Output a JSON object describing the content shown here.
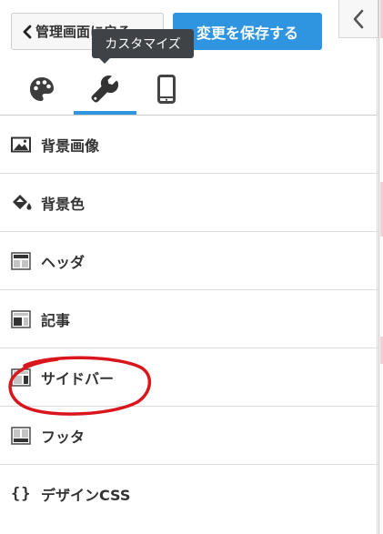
{
  "header": {
    "back_label": "管理画面に戻る",
    "save_label": "変更を保存する"
  },
  "tooltip": {
    "text": "カスタマイズ"
  },
  "tabs": [
    {
      "icon": "palette-icon"
    },
    {
      "icon": "wrench-icon",
      "active": true
    },
    {
      "icon": "smartphone-icon"
    }
  ],
  "menu": {
    "items": [
      {
        "label": "背景画像",
        "icon": "image-icon"
      },
      {
        "label": "背景色",
        "icon": "paint-bucket-icon"
      },
      {
        "label": "ヘッダ",
        "icon": "layout-header-icon"
      },
      {
        "label": "記事",
        "icon": "layout-article-icon"
      },
      {
        "label": "サイドバー",
        "icon": "layout-sidebar-icon"
      },
      {
        "label": "フッタ",
        "icon": "layout-footer-icon"
      },
      {
        "label": "デザインCSS",
        "icon": "braces-icon",
        "icon_text": "{}"
      }
    ]
  },
  "colors": {
    "accent": "#2f95e0",
    "tooltip_bg": "#3f4347",
    "annotation": "#d9161c",
    "text": "#333333"
  }
}
